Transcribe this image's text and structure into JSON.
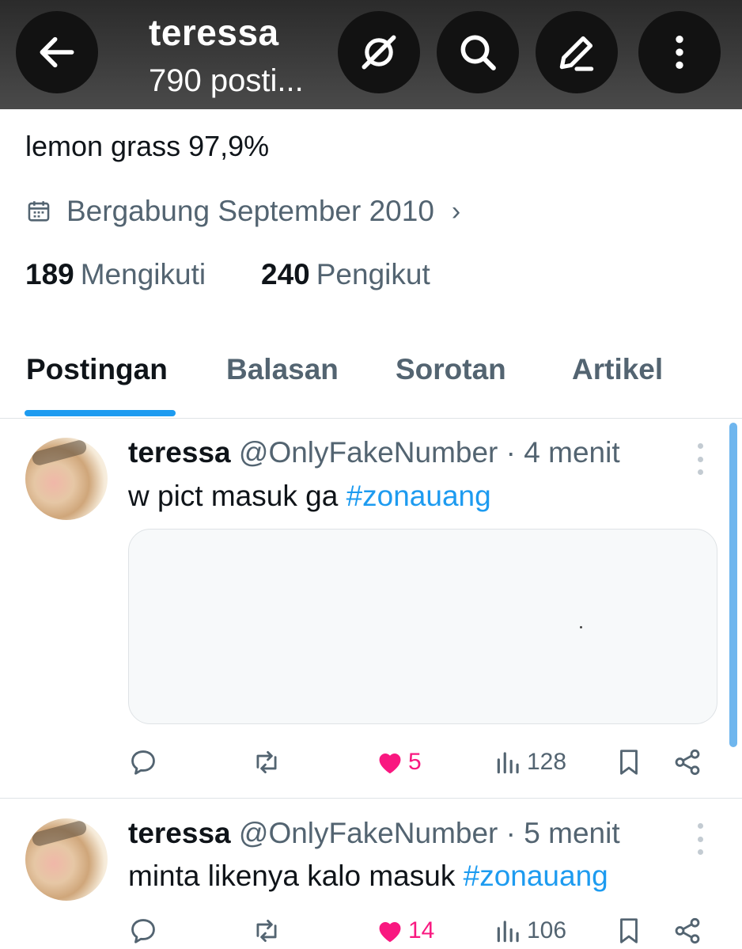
{
  "header": {
    "title": "teressa",
    "subtitle": "790 posti...",
    "icons": [
      "back-arrow-icon",
      "grok-icon",
      "search-icon",
      "edit-icon",
      "more-vertical-icon"
    ]
  },
  "profile": {
    "bio": "lemon grass 97,9%",
    "joined": "Bergabung September 2010",
    "following_count": "189",
    "following_label": "Mengikuti",
    "followers_count": "240",
    "followers_label": "Pengikut"
  },
  "tabs": [
    {
      "label": "Postingan",
      "active": true
    },
    {
      "label": "Balasan",
      "active": false
    },
    {
      "label": "Sorotan",
      "active": false
    },
    {
      "label": "Artikel",
      "active": false
    }
  ],
  "posts": [
    {
      "name": "teressa",
      "handle": "@OnlyFakeNumber",
      "time": "· 4 menit",
      "text": "w pict masuk ga ",
      "hashtag": "#zonauang",
      "likes": "5",
      "views": "128"
    },
    {
      "name": "teressa",
      "handle": "@OnlyFakeNumber",
      "time": "· 5 menit",
      "text": "minta likenya kalo masuk ",
      "hashtag": "#zonauang",
      "likes": "14",
      "views": "106"
    }
  ],
  "colors": {
    "accent": "#1d9bf0",
    "like": "#f91880",
    "muted_text": "#536471",
    "header_bg": "#3a3a3a"
  }
}
